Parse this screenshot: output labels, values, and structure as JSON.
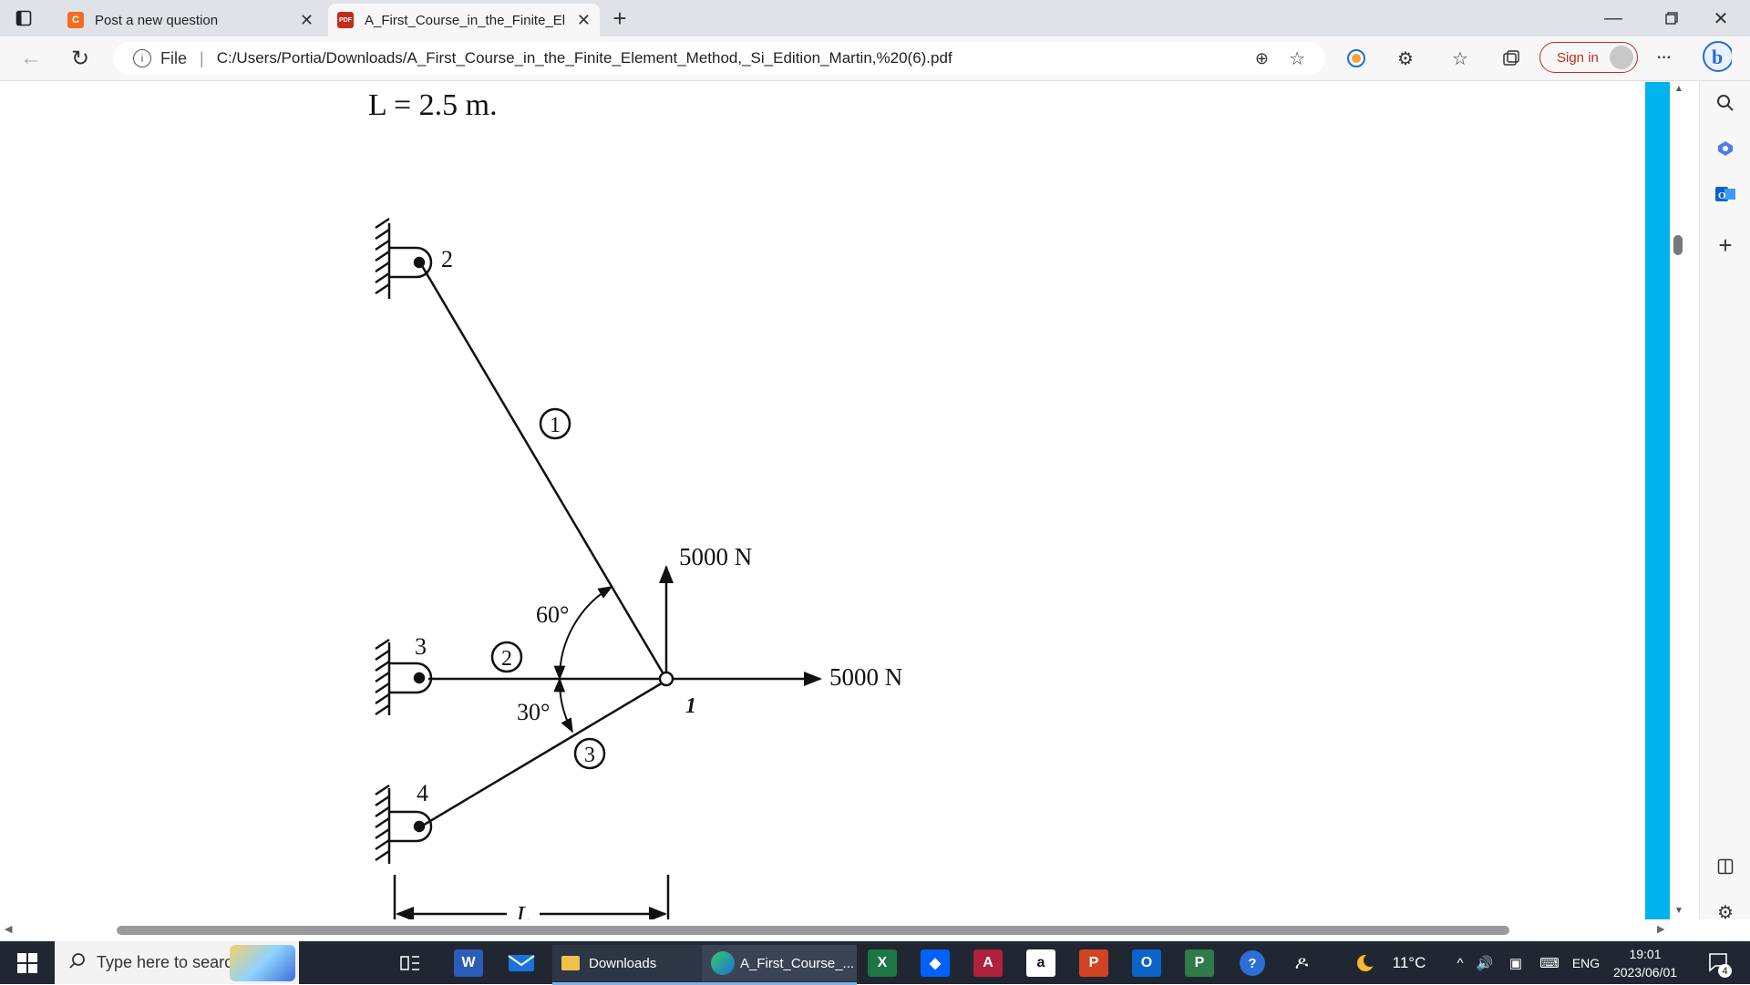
{
  "browser": {
    "tabs": [
      {
        "label": "Post a new question",
        "favicon": "C",
        "favicon_color": "#f36c21"
      },
      {
        "label": "A_First_Course_in_the_Finite_Elem",
        "favicon": "PDF",
        "favicon_color": "#c42b1c"
      }
    ],
    "new_tab_label": "+",
    "file_label": "File",
    "url": "C:/Users/Portia/Downloads/A_First_Course_in_the_Finite_Element_Method,_Si_Edition_Martin,%20(6).pdf",
    "sign_in_label": "Sign in",
    "more_label": "···"
  },
  "document": {
    "length_label": "L = 2.5 m.",
    "figure": {
      "node_labels": [
        "1",
        "2",
        "3",
        "4"
      ],
      "element_labels": [
        "1",
        "2",
        "3"
      ],
      "angle_top": "60°",
      "angle_bottom": "30°",
      "force_vertical": "5000 N",
      "force_horizontal": "5000 N",
      "dimension_label": "L"
    }
  },
  "taskbar": {
    "search_placeholder": "Type here to search",
    "downloads_label": "Downloads",
    "pdf_window_label": "A_First_Course_...",
    "temperature": "11°C",
    "language": "ENG",
    "time": "19:01",
    "date": "2023/06/01",
    "notification_count": "4"
  },
  "colors": {
    "scrollbar_accent": "#00b2ee",
    "sign_in_accent": "#c42b1c",
    "taskbar_bg": "#202732"
  }
}
